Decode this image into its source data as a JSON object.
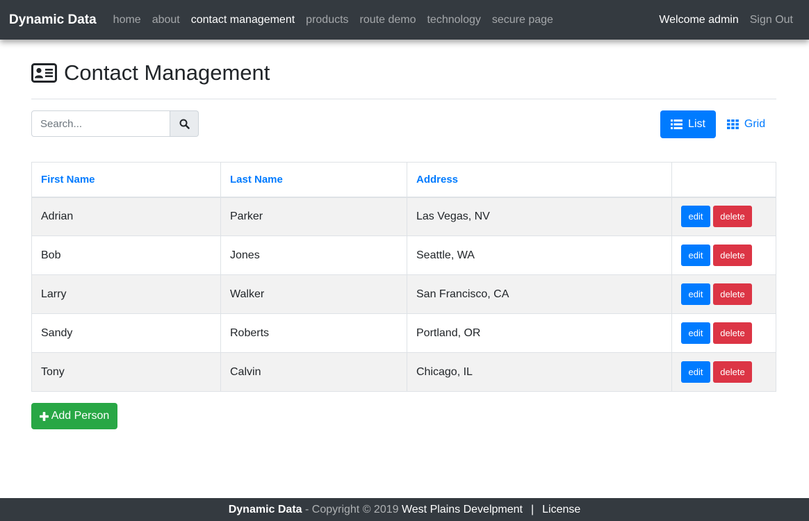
{
  "navbar": {
    "brand": "Dynamic Data",
    "links": [
      {
        "label": "home"
      },
      {
        "label": "about"
      },
      {
        "label": "contact management"
      },
      {
        "label": "products"
      },
      {
        "label": "route demo"
      },
      {
        "label": "technology"
      },
      {
        "label": "secure page"
      }
    ],
    "active_link": "contact management",
    "welcome": "Welcome admin",
    "sign_out": "Sign Out"
  },
  "page": {
    "icon": "address-card-icon",
    "title": "Contact Management"
  },
  "search": {
    "placeholder": "Search...",
    "value": "",
    "button_icon": "search-icon"
  },
  "view_toggle": {
    "list_label": "List",
    "list_icon": "list-icon",
    "grid_label": "Grid",
    "grid_icon": "grid-icon",
    "active": "List"
  },
  "table": {
    "headers": [
      "First Name",
      "Last Name",
      "Address",
      ""
    ],
    "rows": [
      {
        "first": "Adrian",
        "last": "Parker",
        "address": "Las Vegas, NV"
      },
      {
        "first": "Bob",
        "last": "Jones",
        "address": "Seattle, WA"
      },
      {
        "first": "Larry",
        "last": "Walker",
        "address": "San Francisco, CA"
      },
      {
        "first": "Sandy",
        "last": "Roberts",
        "address": "Portland, OR"
      },
      {
        "first": "Tony",
        "last": "Calvin",
        "address": "Chicago, IL"
      }
    ],
    "edit_label": "edit",
    "delete_label": "delete"
  },
  "add_button": {
    "label": "Add Person",
    "icon": "plus-icon"
  },
  "footer": {
    "brand": "Dynamic Data",
    "copyright": " - Copyright © 2019 ",
    "company": "West Plains Develpment",
    "separator": "|",
    "license": "License"
  },
  "colors": {
    "navbar_bg": "#343a40",
    "primary": "#007bff",
    "danger": "#dc3545",
    "success": "#28a745",
    "stripe": "#f2f2f2"
  }
}
